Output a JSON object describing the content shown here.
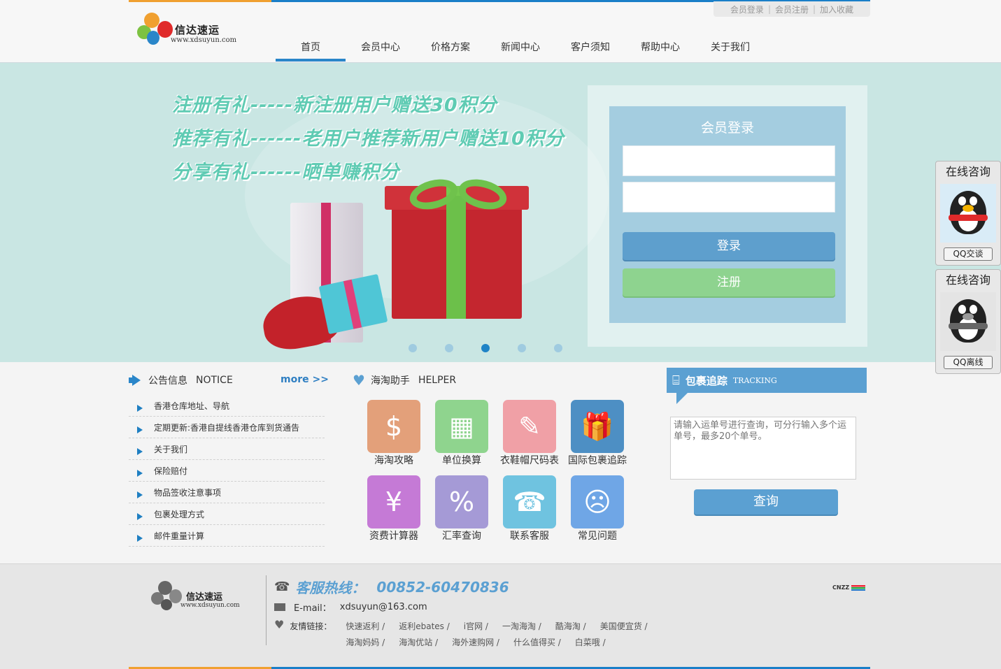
{
  "header": {
    "logo_name": "信达速运",
    "logo_url": "www.xdsuyun.com",
    "top_links": [
      "会员登录",
      "会员注册",
      "加入收藏"
    ],
    "nav": [
      "首页",
      "会员中心",
      "价格方案",
      "新闻中心",
      "客户须知",
      "帮助中心",
      "关于我们"
    ],
    "active_nav": "首页"
  },
  "banner": {
    "promos": [
      "注册有礼-----新注册用户赠送30积分",
      "推荐有礼------老用户推荐新用户赠送10积分",
      "分享有礼------晒单赚积分"
    ],
    "slide_count": 5,
    "active_slide": 3
  },
  "login": {
    "title": "会员登录",
    "username_value": "",
    "password_value": "",
    "login_button": "登录",
    "register_button": "注册"
  },
  "qq_panels": [
    {
      "head": "在线咨询",
      "button": "QQ交谈",
      "status": "online"
    },
    {
      "head": "在线咨询",
      "button": "QQ离线",
      "status": "offline"
    }
  ],
  "notice": {
    "title": "公告信息",
    "title_en": "NOTICE",
    "more": "more >>",
    "items": [
      "香港仓库地址、导航",
      "定期更新:香港自提线香港仓库到货通告",
      "关于我们",
      "保险赔付",
      "物品签收注意事项",
      "包裹处理方式",
      "邮件重量计算"
    ]
  },
  "helper": {
    "title": "海淘助手",
    "title_en": "HELPER",
    "tiles": [
      {
        "label": "海淘攻略",
        "icon": "shopping-bag-icon",
        "color": "#e3a07a",
        "glyph": "$"
      },
      {
        "label": "单位换算",
        "icon": "calculator-icon",
        "color": "#8fd48e",
        "glyph": "▦"
      },
      {
        "label": "衣鞋帽尺码表",
        "icon": "ruler-pencil-icon",
        "color": "#f0a0a6",
        "glyph": "✎"
      },
      {
        "label": "国际包裹追踪",
        "icon": "gift-icon",
        "color": "#4d8fc4",
        "glyph": "🎁"
      },
      {
        "label": "资费计算器",
        "icon": "wallet-icon",
        "color": "#c57ad6",
        "glyph": "¥"
      },
      {
        "label": "汇率查询",
        "icon": "percent-icon",
        "color": "#a59ad6",
        "glyph": "%"
      },
      {
        "label": "联系客服",
        "icon": "telephone-icon",
        "color": "#6fc3e0",
        "glyph": "☎"
      },
      {
        "label": "常见问题",
        "icon": "confused-face-icon",
        "color": "#6fa6e6",
        "glyph": "☹"
      }
    ]
  },
  "tracking": {
    "title": "包裹追踪",
    "title_en": "TRACKING",
    "placeholder": "请输入运单号进行查询，可分行输入多个运单号，最多20个单号。",
    "button": "查询"
  },
  "footer": {
    "logo_name": "信达速运",
    "logo_url": "www.xdsuyun.com",
    "hotline_label": "客服热线：",
    "hotline_number": "00852-60470836",
    "email_label": "E-mail：",
    "email": "xdsuyun@163.com",
    "links_label": "友情链接：",
    "links": [
      "快速返利 /",
      "返利ebates /",
      "i官网 /",
      "一淘海淘 /",
      "酷海淘 /",
      "美国便宜货 /",
      "海淘妈妈 /",
      "海淘优站 /",
      "海外速购网 /",
      "什么值得买 /",
      "白菜哦 /"
    ],
    "stat_badge": "CNZZ"
  },
  "colors": {
    "accent_blue": "#1a7fc8",
    "accent_orange": "#f0a030",
    "panel_blue": "#5ba0d2",
    "banner_bg": "#c9e6e3"
  }
}
